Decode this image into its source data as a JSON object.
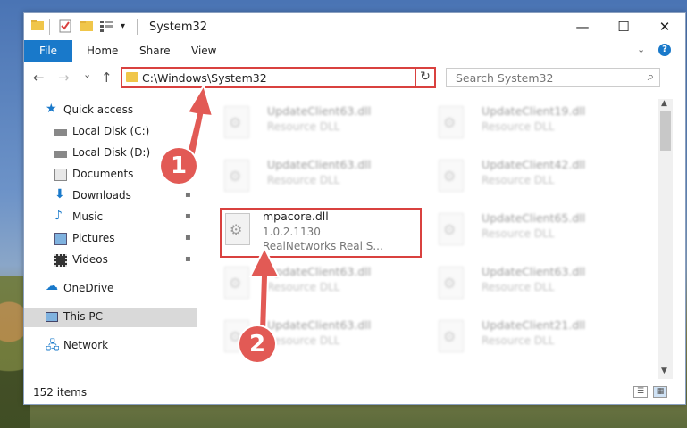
{
  "window": {
    "title": "System32",
    "minimize_glyph": "—",
    "maximize_glyph": "☐",
    "close_glyph": "✕"
  },
  "ribbon": {
    "tabs": [
      "File",
      "Home",
      "Share",
      "View"
    ],
    "collapse_icon": "chevron-down-icon",
    "help_label": "?"
  },
  "nav": {
    "back_glyph": "←",
    "forward_glyph": "→",
    "recent_glyph": "⌄",
    "up_glyph": "↑",
    "address": "C:\\Windows\\System32",
    "address_dropdown_glyph": "⌄",
    "refresh_glyph": "↻",
    "search_placeholder": "Search System32",
    "search_glyph": "⌕"
  },
  "navpane": {
    "quick_access": "Quick access",
    "items": [
      {
        "label": "Local Disk (C:)",
        "icon": "drive-icon",
        "pinned": false
      },
      {
        "label": "Local Disk (D:)",
        "icon": "drive-icon",
        "pinned": false
      },
      {
        "label": "Documents",
        "icon": "documents-icon",
        "pinned": false
      },
      {
        "label": "Downloads",
        "icon": "downloads-icon",
        "pinned": true
      },
      {
        "label": "Music",
        "icon": "music-icon",
        "pinned": true
      },
      {
        "label": "Pictures",
        "icon": "pictures-icon",
        "pinned": true
      },
      {
        "label": "Videos",
        "icon": "videos-icon",
        "pinned": true
      }
    ],
    "onedrive": "OneDrive",
    "this_pc": "This PC",
    "network": "Network",
    "pin_glyph": "📌"
  },
  "files": {
    "left_column": [
      {
        "name": "UpdateClient63.dll",
        "type": "Resource DLL"
      },
      {
        "name": "UpdateClient63.dll",
        "type": "Resource DLL"
      },
      {
        "name": "UpdateClient63.dll",
        "type": "Resource DLL"
      },
      {
        "name": "UpdateClient63.dll",
        "type": "Resource DLL"
      }
    ],
    "right_column": [
      {
        "name": "UpdateClient19.dll",
        "type": "Resource DLL"
      },
      {
        "name": "UpdateClient42.dll",
        "type": "Resource DLL"
      },
      {
        "name": "UpdateClient65.dll",
        "type": "Resource DLL"
      },
      {
        "name": "UpdateClient63.dll",
        "type": "Resource DLL"
      },
      {
        "name": "UpdateClient21.dll",
        "type": "Resource DLL"
      }
    ],
    "highlighted": {
      "name": "mpacore.dll",
      "version": "1.0.2.1130",
      "company": "RealNetworks Real S..."
    }
  },
  "status": {
    "item_count": "152 items"
  },
  "annotations": {
    "callout_1": "1",
    "callout_2": "2",
    "color": "#e25a55"
  }
}
